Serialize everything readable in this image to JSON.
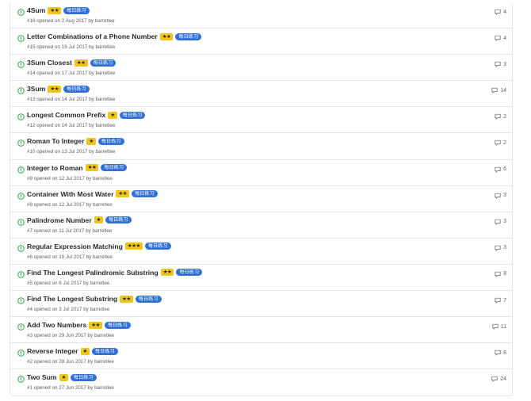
{
  "colors": {
    "open_icon": "#28a745",
    "stars_bg": "#f0c419",
    "tag_bg": "#2f6fd6",
    "title": "#24292e",
    "meta": "#586069",
    "border": "#e1e4e8"
  },
  "icons": {
    "status": "issue-opened-icon",
    "comments": "comment-icon"
  },
  "issues": [
    {
      "title": "4Sum",
      "stars": "★★",
      "tag": "每日练习",
      "meta": "#16 opened on 2 Aug 2017 by barretlee",
      "comments": "4"
    },
    {
      "title": "Letter Combinations of a Phone Number",
      "stars": "★★",
      "tag": "每日练习",
      "meta": "#15 opened on 19 Jul 2017 by barretlee",
      "comments": "4"
    },
    {
      "title": "3Sum Closest",
      "stars": "★★",
      "tag": "每日练习",
      "meta": "#14 opened on 17 Jul 2017 by barretlee",
      "comments": "3"
    },
    {
      "title": "3Sum",
      "stars": "★★",
      "tag": "每日练习",
      "meta": "#13 opened on 14 Jul 2017 by barretlee",
      "comments": "14"
    },
    {
      "title": "Longest Common Prefix",
      "stars": "★",
      "tag": "每日练习",
      "meta": "#12 opened on 14 Jul 2017 by barretlee",
      "comments": "2"
    },
    {
      "title": "Roman To Integer",
      "stars": "★",
      "tag": "每日练习",
      "meta": "#10 opened on 13 Jul 2017 by barretlee",
      "comments": "2"
    },
    {
      "title": "Integer to Roman",
      "stars": "★★",
      "tag": "每日练习",
      "meta": "#9 opened on 12 Jul 2017 by barretlee",
      "comments": "6"
    },
    {
      "title": "Container With Most Water",
      "stars": "★★",
      "tag": "每日练习",
      "meta": "#8 opened on 12 Jul 2017 by barretlee",
      "comments": "3"
    },
    {
      "title": "Palindrome Number",
      "stars": "★",
      "tag": "每日练习",
      "meta": "#7 opened on 11 Jul 2017 by barretlee",
      "comments": "3"
    },
    {
      "title": "Regular Expression Matching",
      "stars": "★★★",
      "tag": "每日练习",
      "meta": "#6 opened on 10 Jul 2017 by barretlee",
      "comments": "3"
    },
    {
      "title": "Find The Longest Palindromic Substring",
      "stars": "★★",
      "tag": "每日练习",
      "meta": "#5 opened on 6 Jul 2017 by barretlee",
      "comments": "8"
    },
    {
      "title": "Find The Longest Substring",
      "stars": "★★",
      "tag": "每日练习",
      "meta": "#4 opened on 3 Jul 2017 by barretlee",
      "comments": "7"
    },
    {
      "title": "Add Two Numbers",
      "stars": "★★",
      "tag": "每日练习",
      "meta": "#3 opened on 29 Jun 2017 by barretlee",
      "comments": "11"
    },
    {
      "title": "Reverse Integer",
      "stars": "★",
      "tag": "每日练习",
      "meta": "#2 opened on 28 Jun 2017 by barretlee",
      "comments": "8"
    },
    {
      "title": "Two Sum",
      "stars": "★",
      "tag": "每日练习",
      "meta": "#1 opened on 27 Jun 2017 by barretlee",
      "comments": "24"
    }
  ]
}
